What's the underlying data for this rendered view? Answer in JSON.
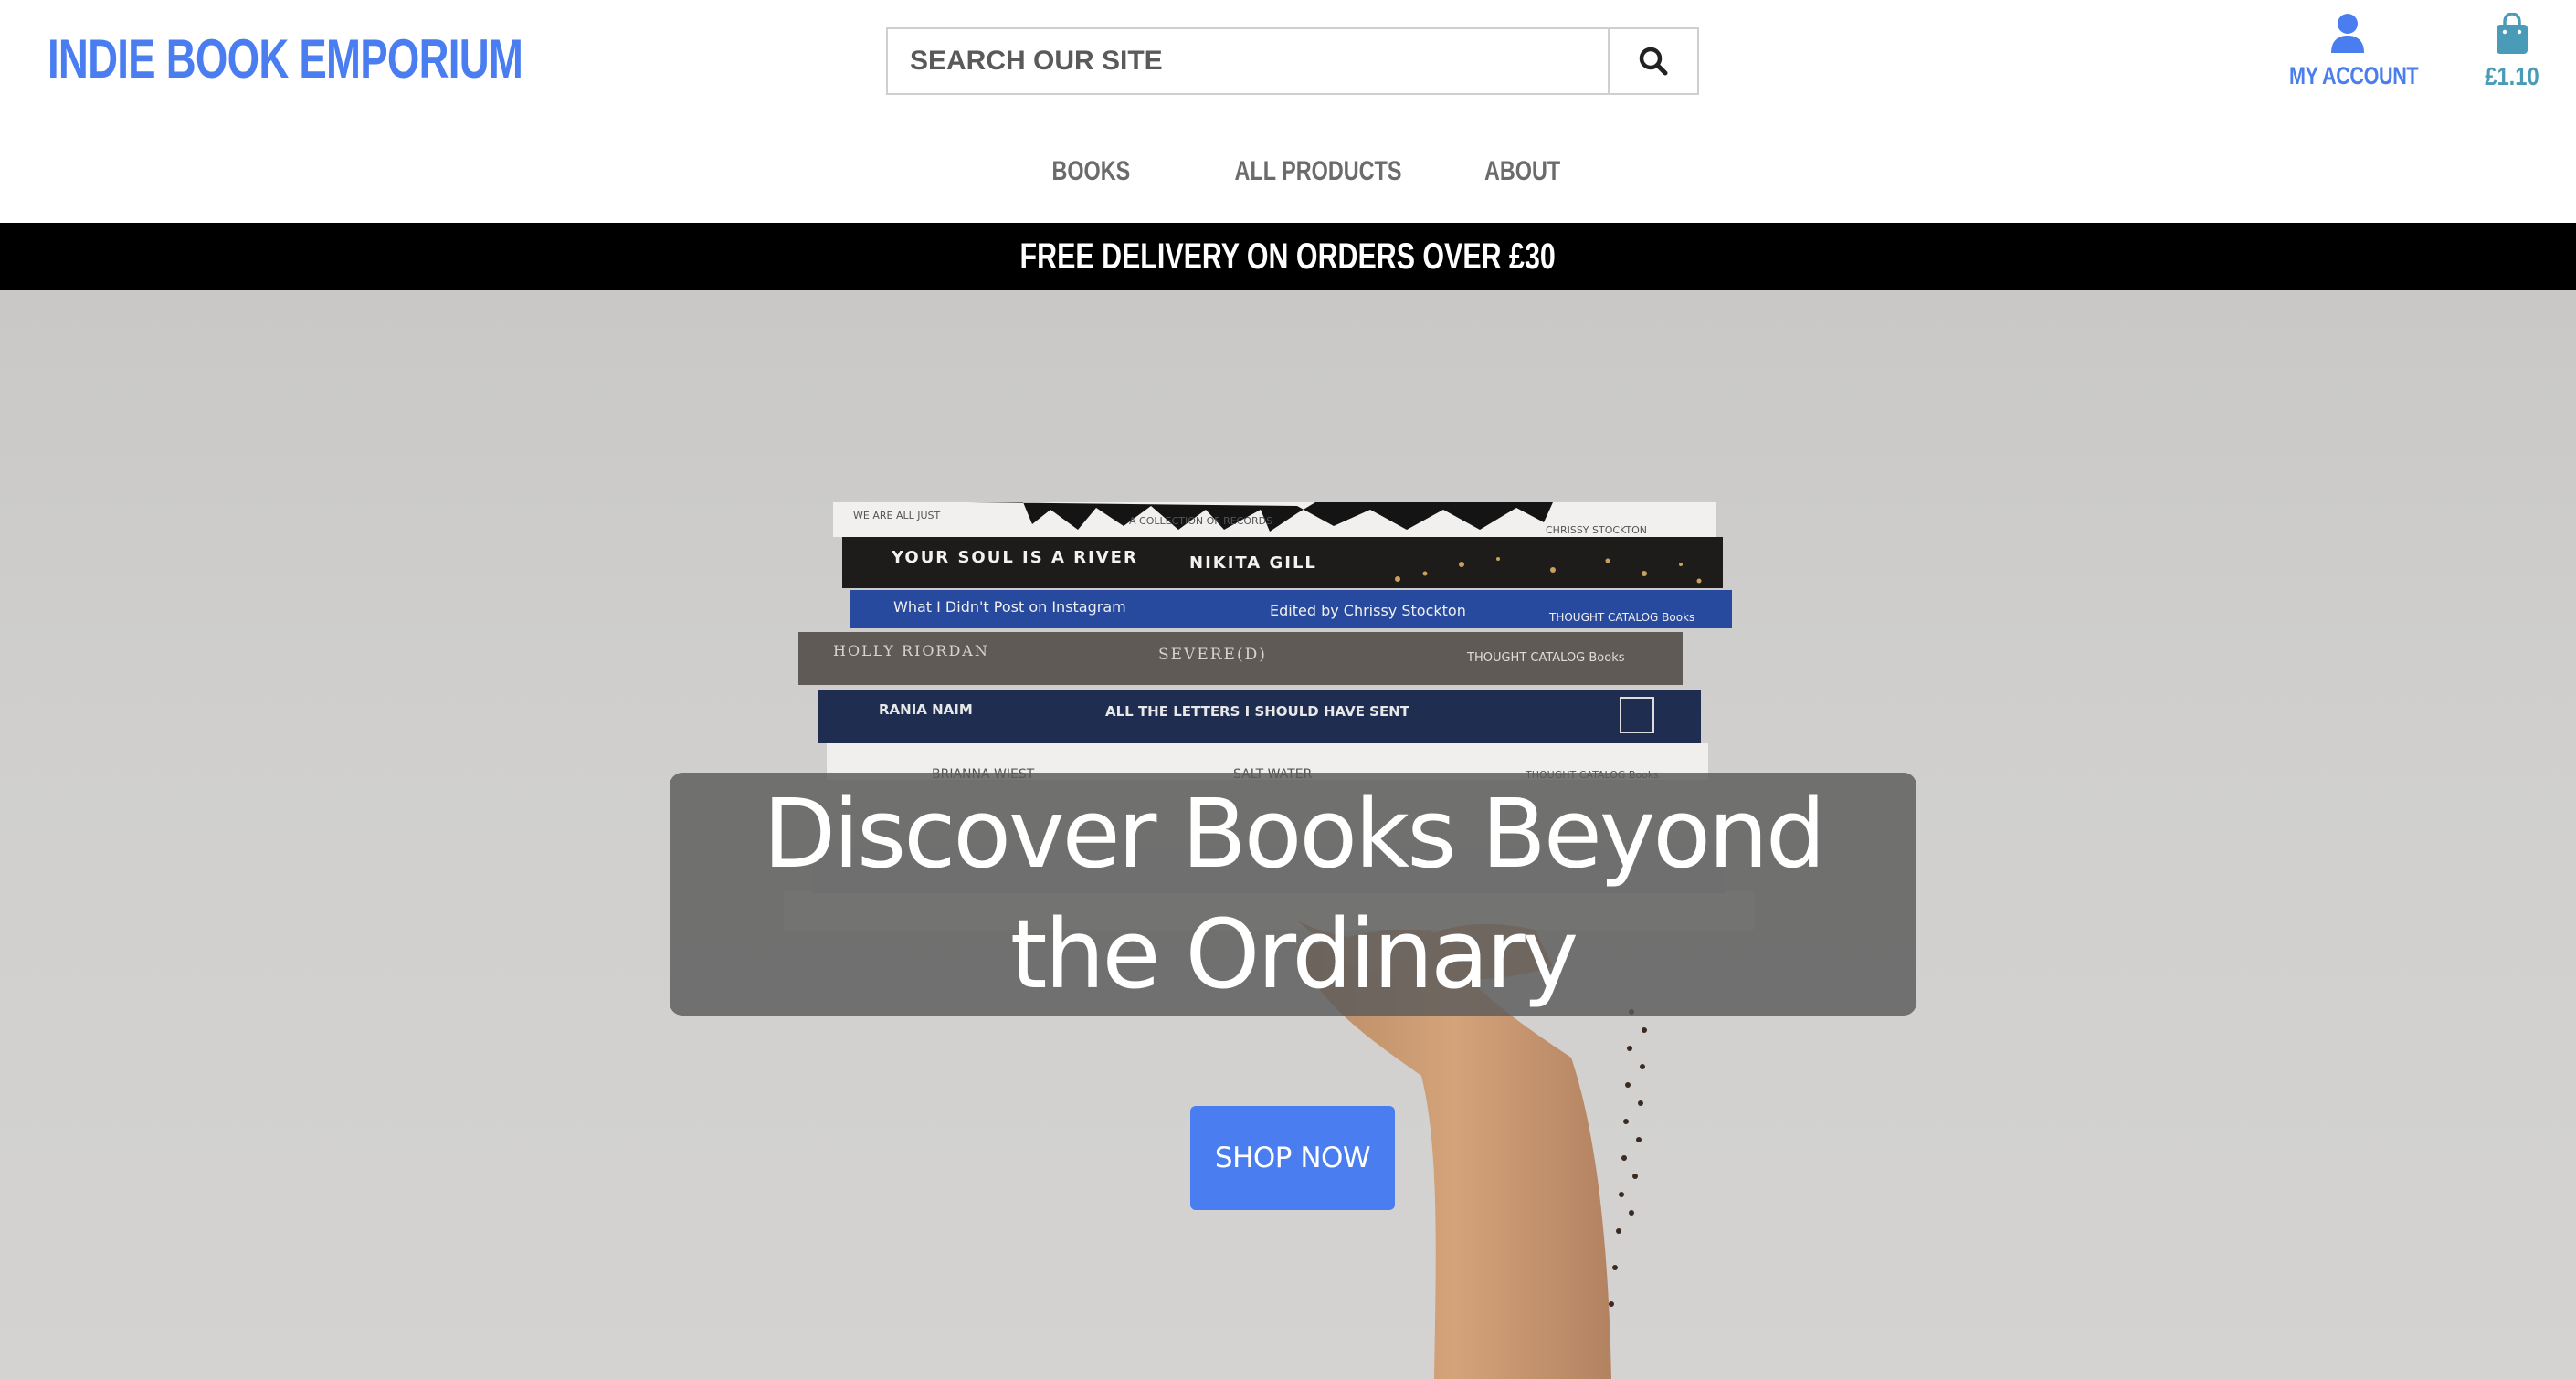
{
  "header": {
    "logo": "INDIE BOOK EMPORIUM",
    "search": {
      "placeholder": "SEARCH OUR SITE",
      "value": ""
    },
    "account_label": "MY ACCOUNT",
    "cart_total": "£1.10"
  },
  "nav": {
    "items": [
      {
        "label": "BOOKS"
      },
      {
        "label": "ALL PRODUCTS"
      },
      {
        "label": "ABOUT"
      }
    ]
  },
  "banner": {
    "text": "FREE DELIVERY ON ORDERS OVER £30"
  },
  "hero": {
    "headline": "Discover Books Beyond the Ordinary",
    "cta_label": "SHOP NOW",
    "photo_book_spines": [
      {
        "left": "WE ARE ALL JUST",
        "middle": "A COLLECTION OF RECORDS",
        "right": "CHRISSY STOCKTON"
      },
      {
        "left": "YOUR SOUL IS A RIVER",
        "middle": "NIKITA GILL",
        "right": ""
      },
      {
        "left": "What I Didn't Post on Instagram",
        "middle": "Edited by Chrissy Stockton",
        "right": "THOUGHT CATALOG Books"
      },
      {
        "left": "HOLLY RIORDAN",
        "middle": "SEVERE(D)",
        "right": "THOUGHT CATALOG Books"
      },
      {
        "left": "RANIA NAIM",
        "middle": "ALL THE LETTERS I SHOULD HAVE SENT",
        "right": ""
      },
      {
        "left": "BRIANNA WIEST",
        "middle": "SALT WATER",
        "right": "THOUGHT CATALOG Books"
      }
    ]
  },
  "colors": {
    "brand_blue": "#4a7ef0",
    "banner_bg": "#000000",
    "headline_overlay": "#5a5a5a"
  },
  "icons": {
    "search": "search-icon",
    "account": "user-icon",
    "cart": "shopping-bag-icon"
  }
}
